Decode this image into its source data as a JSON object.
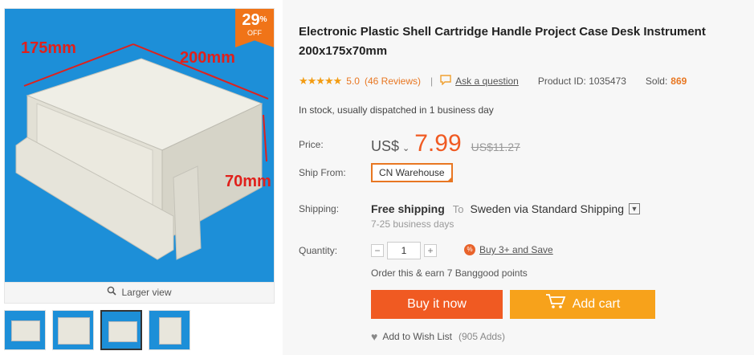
{
  "gallery": {
    "dimensions": [
      "175mm",
      "200mm",
      "70mm"
    ],
    "discount_pct": "29",
    "discount_pct_sign": "%",
    "discount_off": "OFF",
    "larger_view": "Larger view",
    "thumb_count": 4,
    "active_thumb": 2
  },
  "product": {
    "title": "Electronic Plastic Shell Cartridge Handle Project Case Desk Instrument 200x175x70mm",
    "stars": "★★★★★",
    "rating": "5.0",
    "reviews": "(46 Reviews)",
    "separator": "|",
    "ask_question": "Ask a question",
    "product_id": "Product ID: 1035473",
    "sold_label": "Sold:",
    "sold_value": "869",
    "stock": "In stock, usually dispatched in 1 business day"
  },
  "price": {
    "label": "Price:",
    "currency": "US$",
    "caret": "⌄",
    "value": "7.99",
    "old_price": "US$11.27"
  },
  "ship_from": {
    "label": "Ship From:",
    "value": "CN Warehouse"
  },
  "shipping": {
    "label": "Shipping:",
    "free": "Free shipping",
    "to": "To",
    "dest": "Sweden via Standard Shipping",
    "days": "7-25 business days"
  },
  "quantity": {
    "label": "Quantity:",
    "minus": "−",
    "value": "1",
    "plus": "+",
    "buy3_icon": "%",
    "buy3": "Buy 3+ and Save",
    "earn": "Order this & earn 7 Banggood points"
  },
  "actions": {
    "buy_now": "Buy it now",
    "add_cart": "Add cart",
    "wishlist": "Add to Wish List",
    "wishlist_adds": "(905 Adds)"
  },
  "colors": {
    "accent_orange": "#f05a22",
    "cart_orange": "#f7a21b",
    "image_blue": "#1d8fd8"
  }
}
